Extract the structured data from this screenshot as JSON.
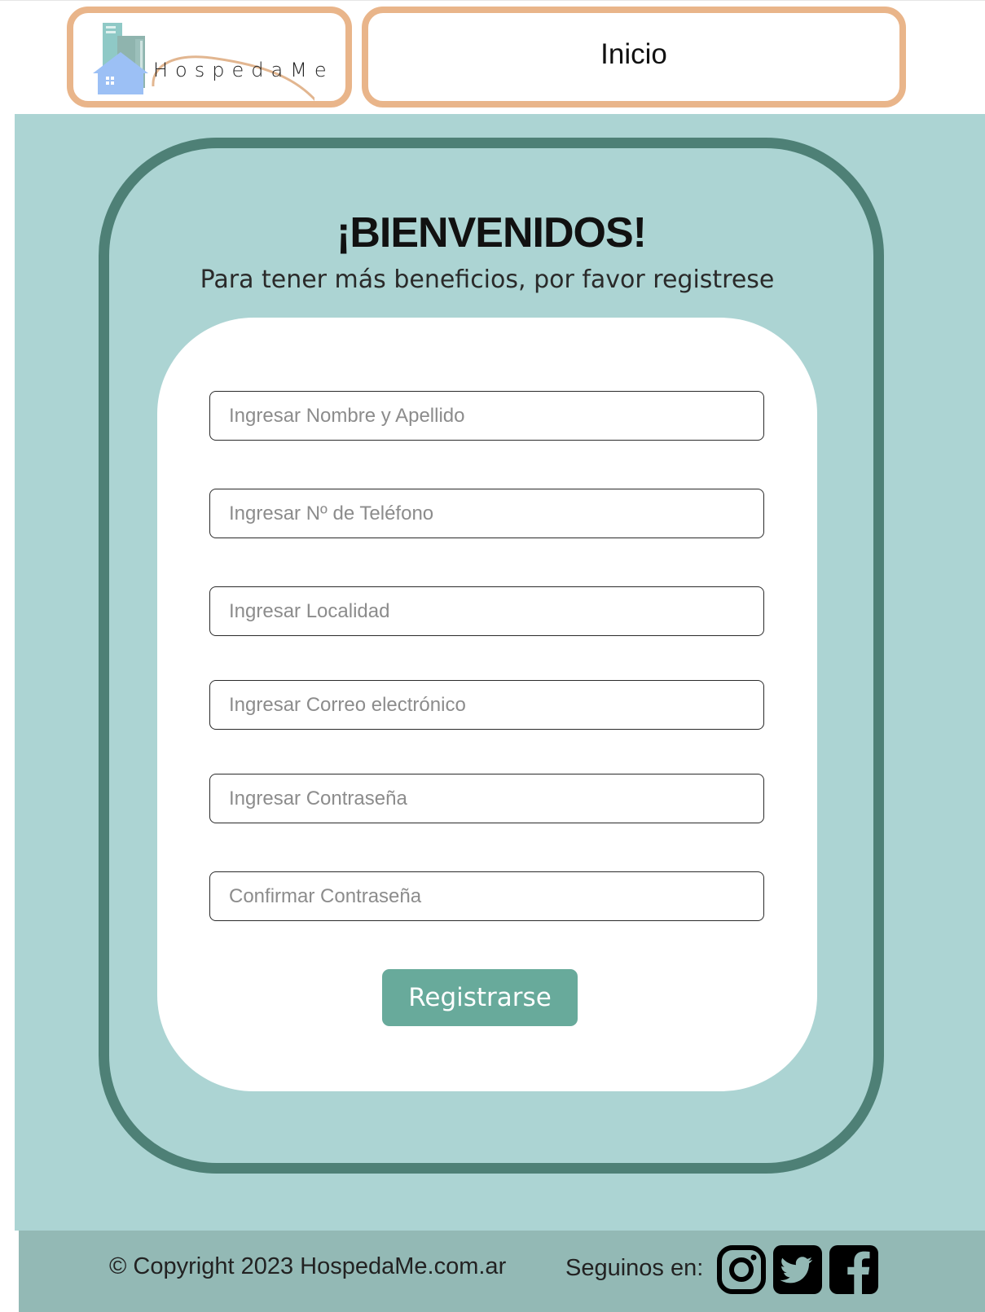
{
  "header": {
    "logo_text": "HospedaMe",
    "logo_icon": "house-buildings-logo",
    "nav_link": "Inicio"
  },
  "main": {
    "title": "¡BIENVENIDOS!",
    "subtitle": "Para tener más beneficios, por favor registrese"
  },
  "form": {
    "fields": [
      {
        "placeholder": "Ingresar Nombre y Apellido",
        "value": ""
      },
      {
        "placeholder": "Ingresar Nº de Teléfono",
        "value": ""
      },
      {
        "placeholder": "Ingresar Localidad",
        "value": ""
      },
      {
        "placeholder": "Ingresar Correo electrónico",
        "value": ""
      },
      {
        "placeholder": "Ingresar Contraseña",
        "value": ""
      },
      {
        "placeholder": "Confirmar Contraseña",
        "value": ""
      }
    ],
    "submit_label": "Registrarse"
  },
  "footer": {
    "copyright": "© Copyright 2023 HospedaMe.com.ar",
    "follow_label": "Seguinos en:",
    "social": [
      "instagram-icon",
      "twitter-icon",
      "facebook-icon"
    ]
  },
  "colors": {
    "header_border": "#e9b58a",
    "main_background": "#acd4d3",
    "frame_border": "#4e8076",
    "button": "#68aa9b",
    "footer": "#93b9b5"
  }
}
